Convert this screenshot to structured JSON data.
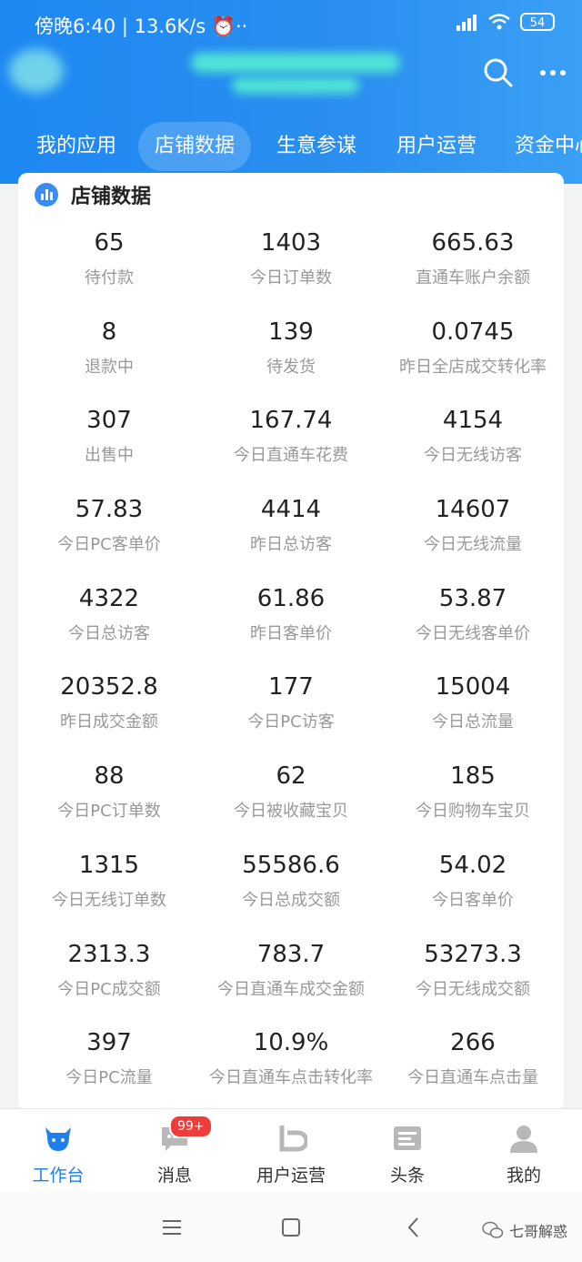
{
  "status_bar": {
    "time": "傍晚6:40",
    "speed": "13.6K/s",
    "battery": "54"
  },
  "nav": {
    "items": [
      "我的应用",
      "店铺数据",
      "生意参谋",
      "用户运营",
      "资金中心"
    ],
    "active_index": 1
  },
  "card": {
    "title": "店铺数据",
    "metrics": [
      {
        "value": "65",
        "label": "待付款"
      },
      {
        "value": "1403",
        "label": "今日订单数"
      },
      {
        "value": "665.63",
        "label": "直通车账户余额"
      },
      {
        "value": "8",
        "label": "退款中"
      },
      {
        "value": "139",
        "label": "待发货"
      },
      {
        "value": "0.0745",
        "label": "昨日全店成交转化率"
      },
      {
        "value": "307",
        "label": "出售中"
      },
      {
        "value": "167.74",
        "label": "今日直通车花费"
      },
      {
        "value": "4154",
        "label": "今日无线访客"
      },
      {
        "value": "57.83",
        "label": "今日PC客单价"
      },
      {
        "value": "4414",
        "label": "昨日总访客"
      },
      {
        "value": "14607",
        "label": "今日无线流量"
      },
      {
        "value": "4322",
        "label": "今日总访客"
      },
      {
        "value": "61.86",
        "label": "昨日客单价"
      },
      {
        "value": "53.87",
        "label": "今日无线客单价"
      },
      {
        "value": "20352.8",
        "label": "昨日成交金额"
      },
      {
        "value": "177",
        "label": "今日PC访客"
      },
      {
        "value": "15004",
        "label": "今日总流量"
      },
      {
        "value": "88",
        "label": "今日PC订单数"
      },
      {
        "value": "62",
        "label": "今日被收藏宝贝"
      },
      {
        "value": "185",
        "label": "今日购物车宝贝"
      },
      {
        "value": "1315",
        "label": "今日无线订单数"
      },
      {
        "value": "55586.6",
        "label": "今日总成交额"
      },
      {
        "value": "54.02",
        "label": "今日客单价"
      },
      {
        "value": "2313.3",
        "label": "今日PC成交额"
      },
      {
        "value": "783.7",
        "label": "今日直通车成交金额"
      },
      {
        "value": "53273.3",
        "label": "今日无线成交额"
      },
      {
        "value": "397",
        "label": "今日PC流量"
      },
      {
        "value": "10.9%",
        "label": "今日直通车点击转化率"
      },
      {
        "value": "266",
        "label": "今日直通车点击量"
      }
    ]
  },
  "tabbar": {
    "items": [
      {
        "label": "工作台",
        "icon": "cow-icon"
      },
      {
        "label": "消息",
        "icon": "message-icon",
        "badge": "99+"
      },
      {
        "label": "用户运营",
        "icon": "user-ops-icon"
      },
      {
        "label": "头条",
        "icon": "news-icon"
      },
      {
        "label": "我的",
        "icon": "profile-icon"
      }
    ],
    "active_index": 0
  },
  "watermark": "七哥解惑",
  "colors": {
    "header": "#1e88f2",
    "accent": "#1e7ef0",
    "badge": "#f03b3b"
  }
}
